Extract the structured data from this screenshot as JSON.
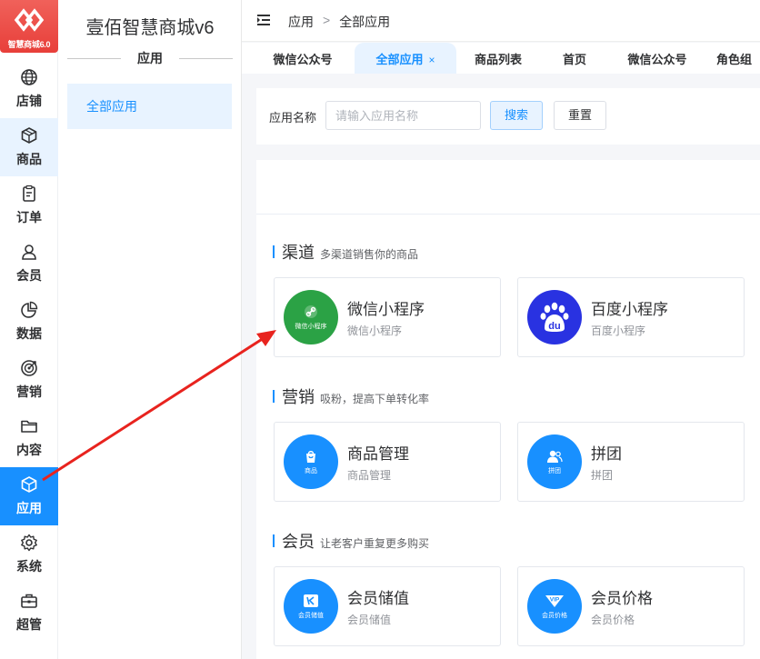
{
  "brand": {
    "logo_text": "智慧商城6.0",
    "title": "壹佰智慧商城v6"
  },
  "rail": [
    {
      "icon": "globe-icon",
      "label": "店铺",
      "state": "normal"
    },
    {
      "icon": "box-icon",
      "label": "商品",
      "state": "soft"
    },
    {
      "icon": "clipboard-icon",
      "label": "订单",
      "state": "normal"
    },
    {
      "icon": "user-icon",
      "label": "会员",
      "state": "normal"
    },
    {
      "icon": "pie-chart-icon",
      "label": "数据",
      "state": "normal"
    },
    {
      "icon": "target-icon",
      "label": "营销",
      "state": "normal"
    },
    {
      "icon": "folder-icon",
      "label": "内容",
      "state": "normal"
    },
    {
      "icon": "cube-icon",
      "label": "应用",
      "state": "active"
    },
    {
      "icon": "gear-icon",
      "label": "系统",
      "state": "normal"
    },
    {
      "icon": "toolbox-icon",
      "label": "超管",
      "state": "normal"
    }
  ],
  "sidebar": {
    "section_title": "应用",
    "item": "全部应用"
  },
  "breadcrumb": {
    "root": "应用",
    "separator": ">",
    "current": "全部应用"
  },
  "tabs": [
    {
      "label": "微信公众号",
      "active": false
    },
    {
      "label": "全部应用",
      "active": true,
      "close": "×"
    },
    {
      "label": "商品列表",
      "active": false
    },
    {
      "label": "首页",
      "active": false
    },
    {
      "label": "微信公众号",
      "active": false
    },
    {
      "label": "角色组",
      "active": false
    }
  ],
  "search": {
    "label": "应用名称",
    "placeholder": "请输入应用名称",
    "value": "",
    "search_btn": "搜索",
    "reset_btn": "重置"
  },
  "sections": [
    {
      "name": "渠道",
      "desc": "多渠道销售你的商品",
      "apps": [
        {
          "name": "微信小程序",
          "sub": "微信小程序",
          "icon": "link-icon",
          "icon_text": "微信小程序",
          "color": "#2ba245"
        },
        {
          "name": "百度小程序",
          "sub": "百度小程序",
          "icon": "baidu-paw-icon",
          "icon_text": "du",
          "color": "#2932e1"
        }
      ]
    },
    {
      "name": "营销",
      "desc": "吸粉，提高下单转化率",
      "apps": [
        {
          "name": "商品管理",
          "sub": "商品管理",
          "icon": "shopping-bag-icon",
          "icon_text": "商品",
          "color": "#1890ff"
        },
        {
          "name": "拼团",
          "sub": "拼团",
          "icon": "group-users-icon",
          "icon_text": "拼团",
          "color": "#1890ff"
        }
      ]
    },
    {
      "name": "会员",
      "desc": "让老客户重复更多购买",
      "apps": [
        {
          "name": "会员储值",
          "sub": "会员储值",
          "icon": "stored-value-icon",
          "icon_text": "会员储值",
          "color": "#1890ff"
        },
        {
          "name": "会员价格",
          "sub": "会员价格",
          "icon": "vip-icon",
          "icon_text": "会员价格",
          "color": "#1890ff"
        }
      ]
    }
  ],
  "colors": {
    "accent": "#1890ff",
    "accent_soft": "#e8f3ff",
    "logo": "#e8413c",
    "arrow": "#e8231e"
  }
}
